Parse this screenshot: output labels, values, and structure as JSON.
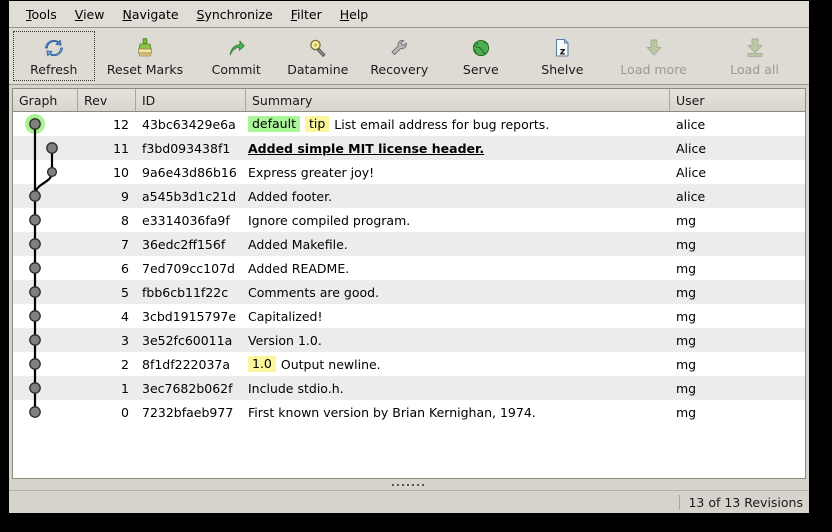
{
  "menu": {
    "items": [
      {
        "label": "Tools",
        "mnemonic": "T"
      },
      {
        "label": "View",
        "mnemonic": "V"
      },
      {
        "label": "Navigate",
        "mnemonic": "N"
      },
      {
        "label": "Synchronize",
        "mnemonic": "S"
      },
      {
        "label": "Filter",
        "mnemonic": "F"
      },
      {
        "label": "Help",
        "mnemonic": "H"
      }
    ]
  },
  "toolbar": {
    "buttons": [
      {
        "label": "Refresh",
        "icon": "refresh-icon",
        "disabled": false,
        "focused": true
      },
      {
        "label": "Reset Marks",
        "icon": "brush-icon",
        "disabled": false,
        "focused": false
      },
      {
        "label": "Commit",
        "icon": "arrow-up-right-icon",
        "disabled": false,
        "focused": false
      },
      {
        "label": "Datamine",
        "icon": "magnifier-key-icon",
        "disabled": false,
        "focused": false
      },
      {
        "label": "Recovery",
        "icon": "wrench-icon",
        "disabled": false,
        "focused": false
      },
      {
        "label": "Serve",
        "icon": "globe-icon",
        "disabled": false,
        "focused": false
      },
      {
        "label": "Shelve",
        "icon": "document-z-icon",
        "disabled": false,
        "focused": false
      },
      {
        "label": "Load more",
        "icon": "download-arrow-icon",
        "disabled": true,
        "focused": false
      },
      {
        "label": "Load all",
        "icon": "download-all-icon",
        "disabled": true,
        "focused": false
      }
    ]
  },
  "table": {
    "columns": [
      "Graph",
      "Rev",
      "ID",
      "Summary",
      "User"
    ],
    "rows": [
      {
        "rev": "12",
        "id": "43bc63429e6a",
        "tags": [
          {
            "text": "default",
            "kind": "branch"
          },
          {
            "text": "tip",
            "kind": "tip"
          }
        ],
        "summary": "List email address for bug reports.",
        "user": "alice",
        "current": false
      },
      {
        "rev": "11",
        "id": "f3bd093438f1",
        "tags": [],
        "summary": "Added simple MIT license header.",
        "user": "Alice",
        "current": true
      },
      {
        "rev": "10",
        "id": "9a6e43d86b16",
        "tags": [],
        "summary": "Express greater joy!",
        "user": "Alice",
        "current": false
      },
      {
        "rev": "9",
        "id": "a545b3d1c21d",
        "tags": [],
        "summary": "Added footer.",
        "user": "alice",
        "current": false
      },
      {
        "rev": "8",
        "id": "e3314036fa9f",
        "tags": [],
        "summary": "Ignore compiled program.",
        "user": "mg",
        "current": false
      },
      {
        "rev": "7",
        "id": "36edc2ff156f",
        "tags": [],
        "summary": "Added Makefile.",
        "user": "mg",
        "current": false
      },
      {
        "rev": "6",
        "id": "7ed709cc107d",
        "tags": [],
        "summary": "Added README.",
        "user": "mg",
        "current": false
      },
      {
        "rev": "5",
        "id": "fbb6cb11f22c",
        "tags": [],
        "summary": "Comments are good.",
        "user": "mg",
        "current": false
      },
      {
        "rev": "4",
        "id": "3cbd1915797e",
        "tags": [],
        "summary": "Capitalized!",
        "user": "mg",
        "current": false
      },
      {
        "rev": "3",
        "id": "3e52fc60011a",
        "tags": [],
        "summary": "Version 1.0.",
        "user": "mg",
        "current": false
      },
      {
        "rev": "2",
        "id": "8f1df222037a",
        "tags": [
          {
            "text": "1.0",
            "kind": "label"
          }
        ],
        "summary": "Output newline.",
        "user": "mg",
        "current": false
      },
      {
        "rev": "1",
        "id": "3ec7682b062f",
        "tags": [],
        "summary": "Include stdio.h.",
        "user": "mg",
        "current": false
      },
      {
        "rev": "0",
        "id": "7232bfaeb977",
        "tags": [],
        "summary": "First known version by Brian Kernighan, 1974.",
        "user": "mg",
        "current": false
      }
    ]
  },
  "graph": {
    "nodes": [
      {
        "rev": "12",
        "x": 22,
        "lane": 0,
        "highlight": true
      },
      {
        "rev": "11",
        "x": 39,
        "lane": 1,
        "highlight": false
      },
      {
        "rev": "10",
        "x": 39,
        "lane": 1,
        "highlight": false
      },
      {
        "rev": "9",
        "x": 22,
        "lane": 0,
        "highlight": false
      },
      {
        "rev": "8",
        "x": 22,
        "lane": 0,
        "highlight": false
      },
      {
        "rev": "7",
        "x": 22,
        "lane": 0,
        "highlight": false
      },
      {
        "rev": "6",
        "x": 22,
        "lane": 0,
        "highlight": false
      },
      {
        "rev": "5",
        "x": 22,
        "lane": 0,
        "highlight": false
      },
      {
        "rev": "4",
        "x": 22,
        "lane": 0,
        "highlight": false
      },
      {
        "rev": "3",
        "x": 22,
        "lane": 0,
        "highlight": false
      },
      {
        "rev": "2",
        "x": 22,
        "lane": 0,
        "highlight": false
      },
      {
        "rev": "1",
        "x": 22,
        "lane": 0,
        "highlight": false
      },
      {
        "rev": "0",
        "x": 22,
        "lane": 0,
        "highlight": false
      }
    ],
    "node_color": "#808080",
    "edge_color": "#000000",
    "highlight_color": "#a9f28f"
  },
  "splitter": {
    "dot_count": 7
  },
  "status": {
    "revisions_text": "13 of 13 Revisions"
  },
  "colors": {
    "window_bg": "#d6d3cc",
    "toolbar_bg": "#dedbd4",
    "row_alt": "#ececec",
    "branch_tag": "#aaf598",
    "tip_tag": "#fbf69a"
  }
}
